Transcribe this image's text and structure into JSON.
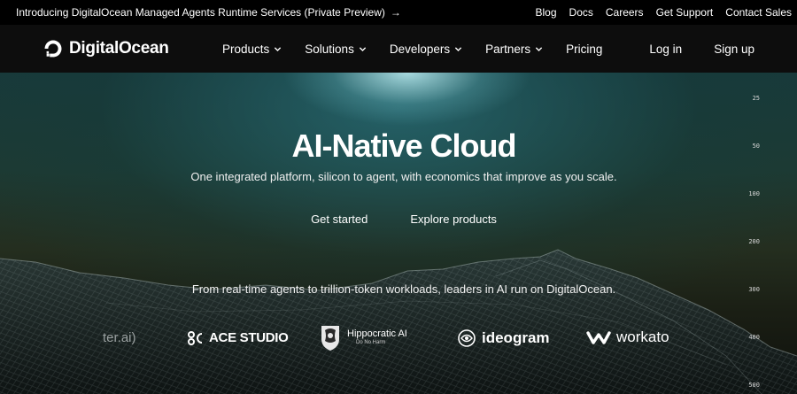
{
  "announcement": {
    "text": "Introducing DigitalOcean Managed Agents Runtime Services (Private Preview)",
    "arrow": "→",
    "links": [
      "Blog",
      "Docs",
      "Careers",
      "Get Support",
      "Contact Sales"
    ]
  },
  "nav": {
    "brand": "DigitalOcean",
    "menu": [
      {
        "label": "Products",
        "dropdown": true
      },
      {
        "label": "Solutions",
        "dropdown": true
      },
      {
        "label": "Developers",
        "dropdown": true
      },
      {
        "label": "Partners",
        "dropdown": true
      },
      {
        "label": "Pricing",
        "dropdown": false
      }
    ],
    "login": "Log in",
    "signup": "Sign up"
  },
  "hero": {
    "title": "AI-Native Cloud",
    "subtitle": "One integrated platform, silicon to agent, with economics that improve as you scale.",
    "cta_primary": "Get started",
    "cta_secondary": "Explore products",
    "trust_line": "From real-time agents to trillion-token workloads, leaders in AI run on DigitalOcean."
  },
  "logos": {
    "clipped": "ter.ai)",
    "ace": "ACE STUDIO",
    "hippocratic": "Hippocratic AI",
    "hippocratic_tag": "Do No Harm",
    "ideogram": "ideogram",
    "workato": "workato"
  },
  "ruler": [
    "25",
    "50",
    "100",
    "200",
    "300",
    "400",
    "500"
  ],
  "colors": {
    "background": "#0d0d0d",
    "text": "#ffffff"
  }
}
